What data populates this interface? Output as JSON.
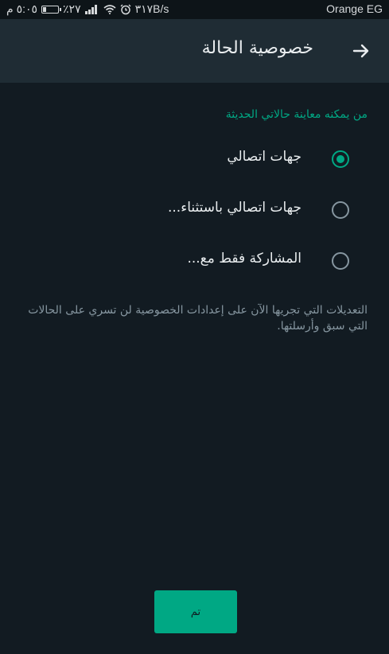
{
  "status_bar": {
    "time": "٥:٠٥ م",
    "battery_percent": "٪٢٧",
    "network_type": "3G",
    "speed": "٣١٧B/s",
    "carrier": "Orange EG"
  },
  "app_bar": {
    "title": "خصوصية الحالة",
    "back_icon": "arrow-right-icon"
  },
  "privacy": {
    "section_header": "من يمكنه معاينة حالاتي الحديثة",
    "options": [
      {
        "label": "جهات اتصالي",
        "selected": true
      },
      {
        "label": "جهات اتصالي باستثناء...",
        "selected": false
      },
      {
        "label": "المشاركة فقط مع...",
        "selected": false
      }
    ],
    "info": "التعديلات التي تجريها الآن على إعدادات الخصوصية لن تسري على الحالات التي سبق وأرسلتها."
  },
  "footer": {
    "done_label": "تم"
  },
  "colors": {
    "accent": "#00a884",
    "background": "#121b22",
    "app_bar": "#1f2c34",
    "secondary_text": "#8696a0"
  }
}
